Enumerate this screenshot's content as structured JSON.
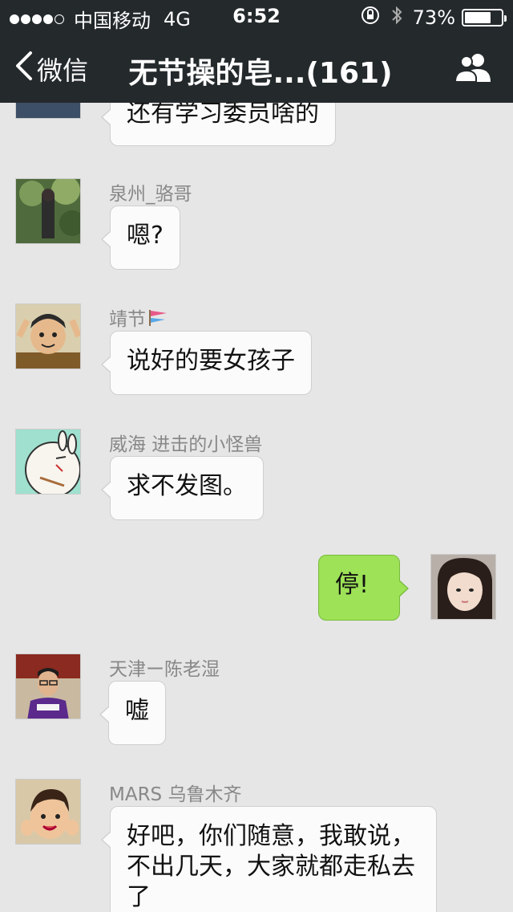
{
  "status_bar": {
    "carrier": "中国移动",
    "network": "4G",
    "time": "6:52",
    "battery_percent_text": "73%",
    "battery_level": 0.73,
    "signal_dots": [
      1,
      1,
      1,
      1,
      0
    ]
  },
  "nav": {
    "back_label": "微信",
    "title": "无节操的皂...(161)",
    "icons": {
      "back": "chevron-left-icon",
      "members": "group-members-icon"
    }
  },
  "colors": {
    "header_bg": "#24292c",
    "chat_bg": "#e6e6e6",
    "incoming_bubble": "#fbfbfb",
    "outgoing_bubble": "#9de257",
    "sender_name": "#888888"
  },
  "messages": [
    {
      "sender": "",
      "text": "还有学习委员啥的",
      "direction": "in"
    },
    {
      "sender": "泉州_骆哥",
      "text": "嗯?",
      "direction": "in"
    },
    {
      "sender": "靖节",
      "text": "说好的要女孩子",
      "direction": "in"
    },
    {
      "sender": "威海 进击的小怪兽",
      "text": "求不发图。",
      "direction": "in"
    },
    {
      "sender": "",
      "text": "停!",
      "direction": "out"
    },
    {
      "sender": "天津ー陈老湿",
      "text": "嘘",
      "direction": "in"
    },
    {
      "sender": "MARS 乌鲁木齐",
      "text": "好吧，你们随意，我敢说，不出几天，大家就都走私去了",
      "direction": "in"
    }
  ]
}
